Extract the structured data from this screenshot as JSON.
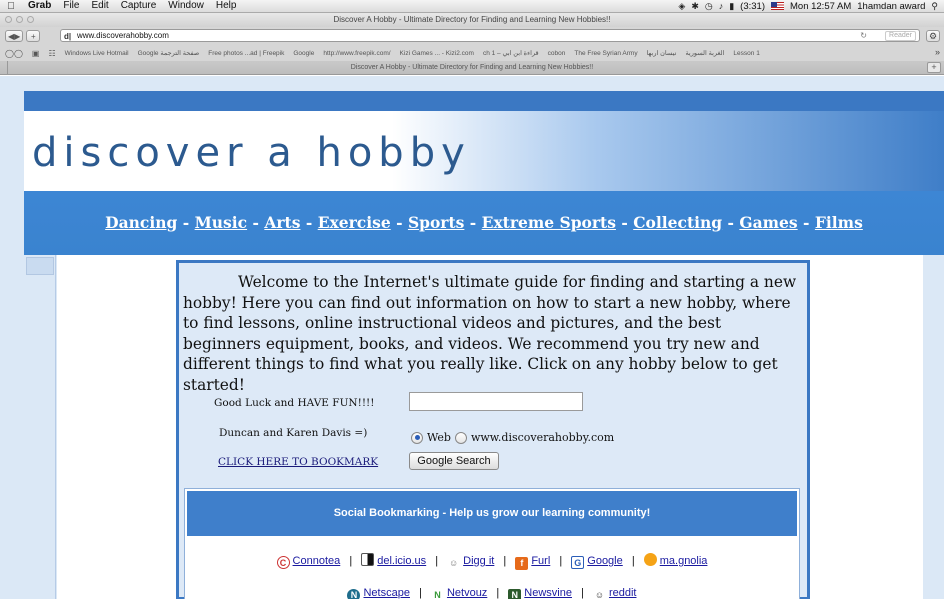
{
  "menubar": {
    "items": [
      "Grab",
      "File",
      "Edit",
      "Capture",
      "Window",
      "Help"
    ],
    "battery": "(3:31)",
    "clock": "Mon 12:57 AM",
    "user": "1hamdan award"
  },
  "browser": {
    "window_title": "Discover A Hobby - Ultimate Directory for Finding and Learning New Hobbies!!",
    "url": "www.discoverahobby.com",
    "reader_label": "Reader",
    "bookmarks": [
      "Windows Live Hotmail",
      "Google صفحة الترجمة",
      "Free photos ...ad | Freepik",
      "Google",
      "http://www.freepik.com/",
      "Kizi Games ... - Kizi2.com",
      "ch 1 – قراءة ابن ابي",
      "cobon",
      "The Free Syrian Army",
      "نيسان اربها",
      "الغربة السورية",
      "Lesson 1"
    ],
    "tab_title": "Discover A Hobby - Ultimate Directory for Finding and Learning New Hobbies!!"
  },
  "site": {
    "logo": "discover a hobby",
    "nav": [
      {
        "label": "Dancing"
      },
      {
        "label": "Music"
      },
      {
        "label": "Arts"
      },
      {
        "label": "Exercise"
      },
      {
        "label": "Sports"
      },
      {
        "label": "Extreme Sports"
      },
      {
        "label": "Collecting"
      },
      {
        "label": "Games"
      },
      {
        "label": "Films"
      }
    ],
    "nav_sep": "-",
    "welcome": "Welcome to the Internet's ultimate guide for finding and starting a new hobby! Here you can find out information on how to start a new hobby, where to find lessons, online instructional videos and pictures, and the best beginners equipment, books, and videos. We recommend you try new and different things to find what you really like. Click on any hobby below to get started!",
    "good_luck": "Good Luck and HAVE FUN!!!!",
    "authors": "Duncan and Karen Davis =)",
    "bookmark_link": "CLICK HERE TO BOOKMARK",
    "search": {
      "value": "",
      "radio_web": "Web",
      "radio_site": "www.discoverahobby.com",
      "selected": "Web",
      "button": "Google Search"
    },
    "social": {
      "heading": "Social Bookmarking - Help us grow our learning community!",
      "row1": [
        "Connotea",
        "del.icio.us",
        "Digg it",
        "Furl",
        "Google",
        "ma.gnolia"
      ],
      "row2": [
        "Netscape",
        "Netvouz",
        "Newsvine",
        "reddit"
      ],
      "separator": "|"
    }
  }
}
